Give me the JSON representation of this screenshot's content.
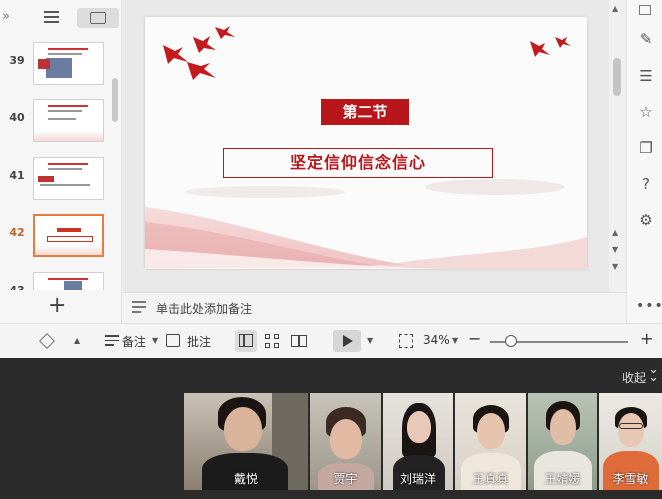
{
  "left_panel": {
    "collapse_glyph": "»",
    "thumbnails": [
      {
        "number": "39",
        "active": false
      },
      {
        "number": "40",
        "active": false
      },
      {
        "number": "41",
        "active": false
      },
      {
        "number": "42",
        "active": true
      },
      {
        "number": "43",
        "active": false
      }
    ],
    "add_slide_glyph": "+"
  },
  "slide": {
    "section_title": "第二节",
    "subtitle": "坚定信仰信念信心"
  },
  "notes": {
    "placeholder": "单击此处添加备注"
  },
  "status_bar": {
    "notes_label": "备注",
    "comment_label": "批注",
    "zoom_level": "34%",
    "zoom_out": "−",
    "zoom_in": "+"
  },
  "meeting": {
    "collapse_label": "收起",
    "participants": [
      {
        "name": "戴悦"
      },
      {
        "name": "贾宇"
      },
      {
        "name": "刘瑞洋"
      },
      {
        "name": "王真真"
      },
      {
        "name": "王婧媛"
      },
      {
        "name": "李雪敏"
      }
    ]
  },
  "colors": {
    "accent_red": "#b8161a",
    "active_thumb": "#e87b3e"
  },
  "icons": [
    "outline-icon",
    "slides-icon",
    "notes-icon",
    "brush-icon",
    "tune-icon",
    "star-icon",
    "copy-icon",
    "help-icon",
    "settings-icon",
    "play-icon",
    "fit-icon"
  ]
}
